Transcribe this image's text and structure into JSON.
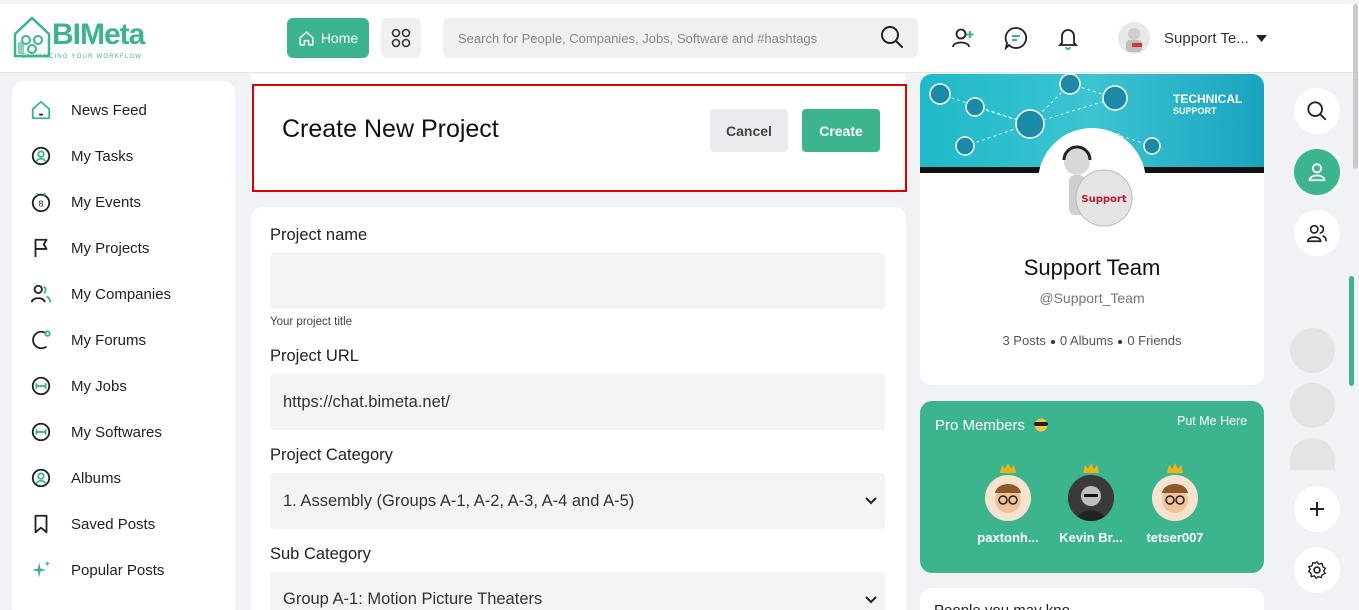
{
  "brand": {
    "name": "BIMeta",
    "tagline": "ENHANCING YOUR WORKFLOW",
    "accent": "#3cb58e"
  },
  "topbar": {
    "home_label": "Home",
    "search_placeholder": "Search for People, Companies, Jobs, Software and #hashtags",
    "user_name": "Support Te..."
  },
  "sidebar": {
    "items": [
      {
        "label": "News Feed",
        "icon": "home-icon"
      },
      {
        "label": "My Tasks",
        "icon": "user-circle-icon"
      },
      {
        "label": "My Events",
        "icon": "calendar-icon"
      },
      {
        "label": "My Projects",
        "icon": "flag-icon"
      },
      {
        "label": "My Companies",
        "icon": "users-icon"
      },
      {
        "label": "My Forums",
        "icon": "forum-icon"
      },
      {
        "label": "My Jobs",
        "icon": "dumbbell-icon"
      },
      {
        "label": "My Softwares",
        "icon": "dumbbell-icon"
      },
      {
        "label": "Albums",
        "icon": "user-circle-icon"
      },
      {
        "label": "Saved Posts",
        "icon": "bookmark-icon"
      },
      {
        "label": "Popular Posts",
        "icon": "sparkle-icon"
      }
    ]
  },
  "main": {
    "title": "Create New Project",
    "cancel_label": "Cancel",
    "create_label": "Create",
    "form": {
      "name_label": "Project name",
      "name_value": "",
      "name_hint": "Your project title",
      "url_label": "Project URL",
      "url_value": "https://chat.bimeta.net/",
      "category_label": "Project Category",
      "category_value": "1. Assembly (Groups A-1, A-2, A-3, A-4 and A-5)",
      "subcategory_label": "Sub Category",
      "subcategory_value": "Group A-1: Motion Picture Theaters"
    }
  },
  "profile": {
    "banner_line1": "TECHNICAL",
    "banner_line2": "SUPPORT",
    "avatar_text": "Support",
    "name": "Support Team",
    "handle": "@Support_Team",
    "posts": "3 Posts",
    "albums": "0 Albums",
    "friends": "0 Friends"
  },
  "pro_members": {
    "title": "Pro Members",
    "link": "Put Me Here",
    "members": [
      {
        "name": "paxtonh..."
      },
      {
        "name": "Kevin Br..."
      },
      {
        "name": "tetser007"
      }
    ]
  },
  "people": {
    "title": "People you may kno"
  }
}
